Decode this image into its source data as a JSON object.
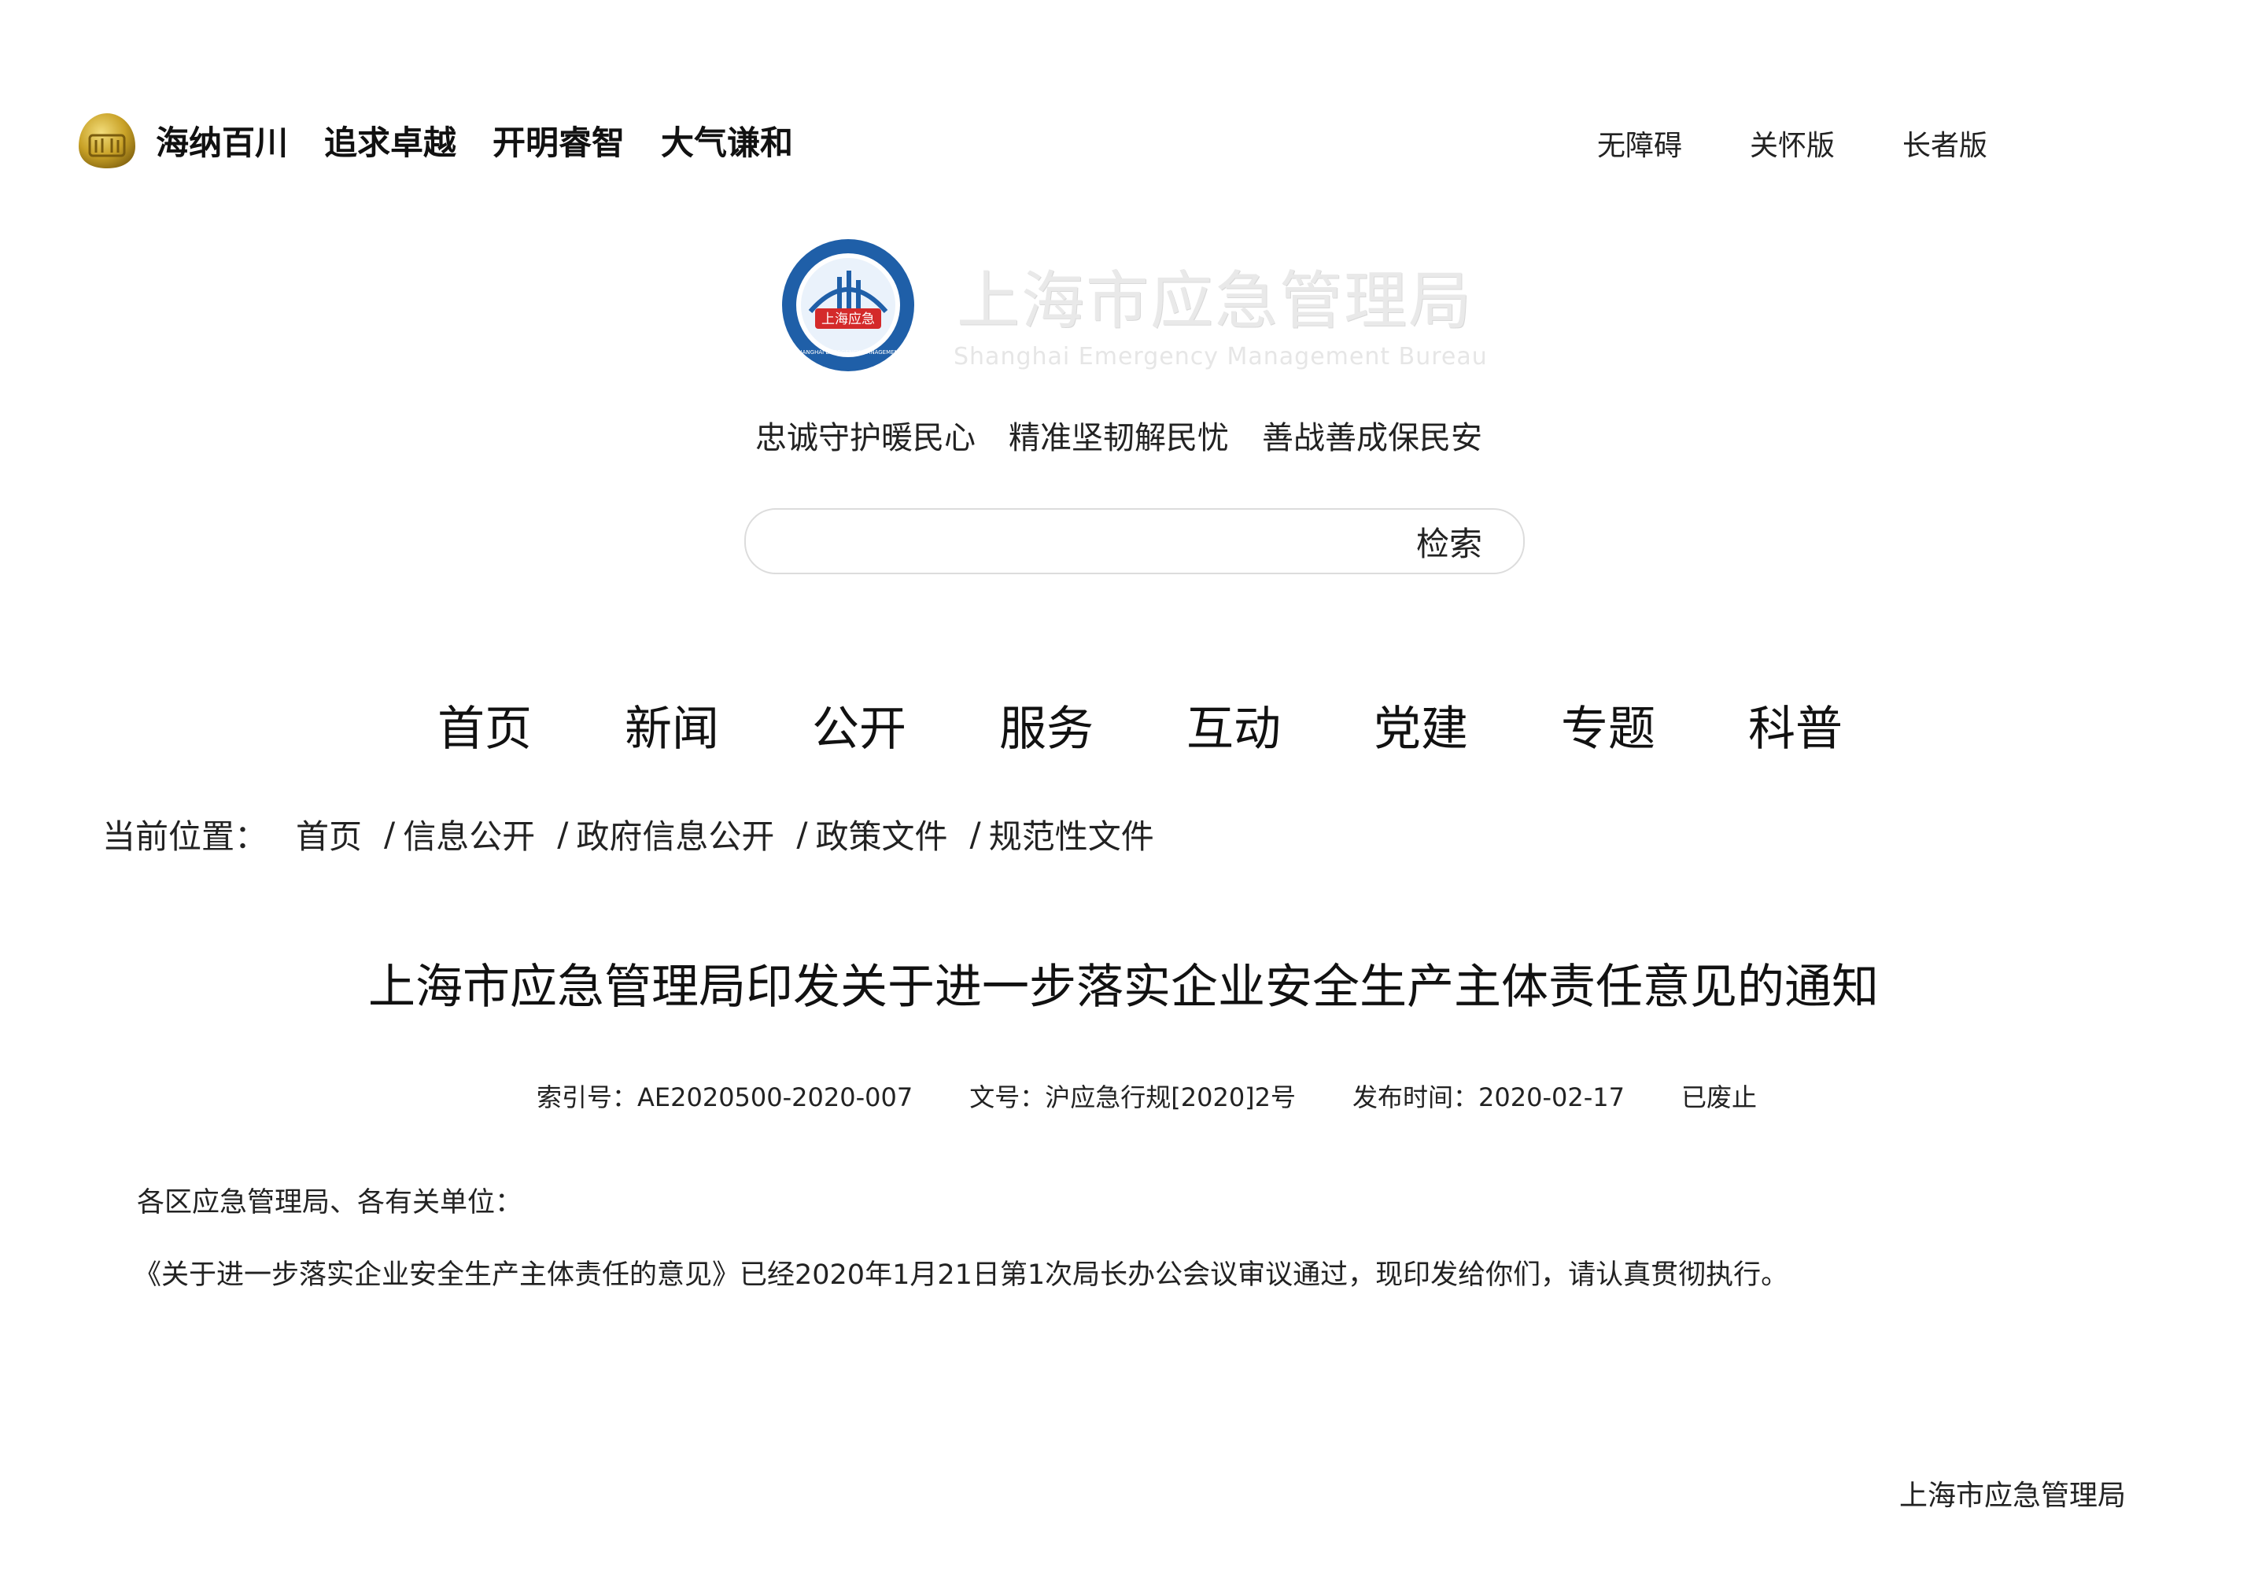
{
  "top_bar": {
    "slogans": [
      "海纳百川",
      "追求卓越",
      "开明睿智",
      "大气谦和"
    ],
    "links": [
      "无障碍",
      "关怀版",
      "长者版"
    ]
  },
  "header": {
    "logo_text": "上海应急",
    "logo_ring_text": "SHANGHAI EMERGENCY MANAGEMENT",
    "site_name_cn": "上海市应急管理局",
    "site_name_en": "Shanghai Emergency Management Bureau",
    "motto": [
      "忠诚守护暖民心",
      "精准坚韧解民忧",
      "善战善成保民安"
    ]
  },
  "search": {
    "placeholder": "",
    "button_label": "检索"
  },
  "nav": {
    "items": [
      "首页",
      "新闻",
      "公开",
      "服务",
      "互动",
      "党建",
      "专题",
      "科普"
    ]
  },
  "breadcrumb": {
    "label": "当前位置：",
    "items": [
      "首页",
      "信息公开",
      "政府信息公开",
      "政策文件",
      "规范性文件"
    ],
    "separator": "/"
  },
  "article": {
    "title": "上海市应急管理局印发关于进一步落实企业安全生产主体责任意见的通知",
    "meta": {
      "index_no": "索引号：AE2020500-2020-007",
      "doc_no": "文号：沪应急行规[2020]2号",
      "publish_time": "发布时间：2020-02-17",
      "status": "已废止"
    },
    "salutation": "各区应急管理局、各有关单位：",
    "paragraph": "《关于进一步落实企业安全生产主体责任的意见》已经2020年1月21日第1次局长办公会议审议通过，现印发给你们，请认真贯彻执行。",
    "signature": "上海市应急管理局"
  },
  "colors": {
    "accent_blue": "#1f5fa8",
    "logo_red": "#d42a2a",
    "emblem_gold": "#c9a227"
  }
}
